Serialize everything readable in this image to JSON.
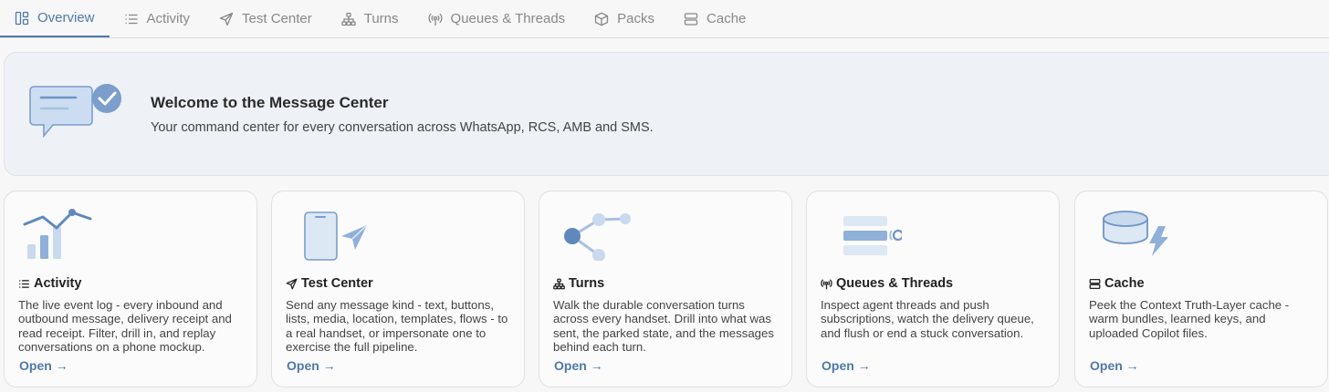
{
  "tabs": [
    {
      "label": "Overview",
      "icon": "layout-icon",
      "active": true
    },
    {
      "label": "Activity",
      "icon": "list-icon"
    },
    {
      "label": "Test Center",
      "icon": "send-icon"
    },
    {
      "label": "Turns",
      "icon": "tree-icon"
    },
    {
      "label": "Queues & Threads",
      "icon": "radio-icon"
    },
    {
      "label": "Packs",
      "icon": "box-icon"
    },
    {
      "label": "Cache",
      "icon": "server-icon"
    }
  ],
  "hero": {
    "title": "Welcome to the Message Center",
    "subtitle": "Your command center for every conversation across WhatsApp, RCS, AMB and SMS."
  },
  "cards": [
    {
      "title": "Activity",
      "description": "The live event log - every inbound and outbound message, delivery receipt and read receipt. Filter, drill in, and replay conversations on a phone mockup.",
      "link": "Open →"
    },
    {
      "title": "Test Center",
      "description": "Send any message kind - text, buttons, lists, media, location, templates, flows - to a real handset, or impersonate one to exercise the full pipeline.",
      "link": "Open →"
    },
    {
      "title": "Turns",
      "description": "Walk the durable conversation turns across every handset. Drill into what was sent, the parked state, and the messages behind each turn.",
      "link": "Open →"
    },
    {
      "title": "Queues & Threads",
      "description": "Inspect agent threads and push subscriptions, watch the delivery queue, and flush or end a stuck conversation.",
      "link": "Open →"
    },
    {
      "title": "Cache",
      "description": "Peek the Context Truth-Layer cache - warm bundles, learned keys, and uploaded Copilot files.",
      "link": "Open →"
    }
  ],
  "colors": {
    "accent": "#5078a8",
    "art_fill": "#c9d9ee",
    "art_stroke": "#6f95c4"
  }
}
